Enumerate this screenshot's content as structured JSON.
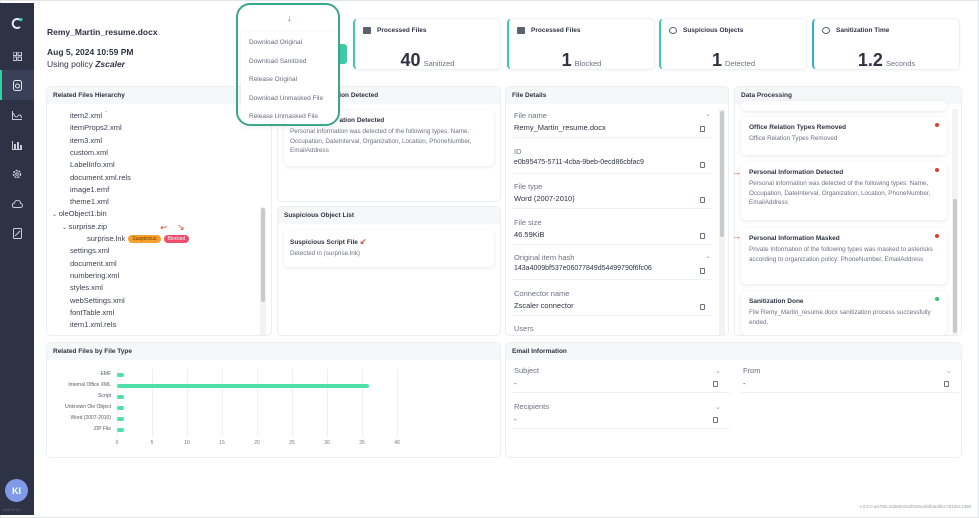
{
  "sidebar": {
    "items": [
      {
        "icon": "logo-icon"
      },
      {
        "icon": "dashboard-icon"
      },
      {
        "icon": "file-scan-icon",
        "active": true
      },
      {
        "icon": "analytics-icon"
      },
      {
        "icon": "reports-icon"
      },
      {
        "icon": "settings-icon"
      },
      {
        "icon": "cloud-icon"
      },
      {
        "icon": "document-icon"
      }
    ],
    "avatar": "KI",
    "version": "v24.07.21"
  },
  "header": {
    "file_name": "Remy_Martin_resume.docx",
    "date": "Aug 5, 2024 10:59 PM",
    "policy_prefix": "Using policy",
    "policy_name": "Zscaler"
  },
  "actions_menu": {
    "items": [
      "Download Original",
      "Download Sanitized",
      "Release Original",
      "Download Unmasked File",
      "Release Unmasked File"
    ]
  },
  "stats": [
    {
      "title": "Processed Files",
      "value": "40",
      "unit": "Sanitized"
    },
    {
      "title": "Processed Files",
      "value": "1",
      "unit": "Blocked"
    },
    {
      "title": "Suspicious Objects",
      "value": "1",
      "unit": "Detected"
    },
    {
      "title": "Sanitization Time",
      "value": "1.2",
      "unit": "Seconds"
    }
  ],
  "hierarchy": {
    "title": "Related Files Hierarchy",
    "items": [
      {
        "name": "item2.xml",
        "level": 1
      },
      {
        "name": "itemProps2.xml",
        "level": 1
      },
      {
        "name": "item3.xml",
        "level": 1
      },
      {
        "name": "custom.xml",
        "level": 1
      },
      {
        "name": "LabelInfo.xml",
        "level": 1
      },
      {
        "name": "document.xml.rels",
        "level": 1
      },
      {
        "name": "image1.emf",
        "level": 1
      },
      {
        "name": "theme1.xml",
        "level": 1
      },
      {
        "name": "oleObject1.bin",
        "level": 0,
        "expanded": true
      },
      {
        "name": "surprise.zip",
        "level": 1,
        "expanded": true
      },
      {
        "name": "surprise.lnk",
        "level": 2,
        "badges": [
          "Suspicious",
          "Blocked"
        ]
      },
      {
        "name": "settings.xml",
        "level": 1
      },
      {
        "name": "document.xml",
        "level": 1
      },
      {
        "name": "numbering.xml",
        "level": 1
      },
      {
        "name": "styles.xml",
        "level": 1
      },
      {
        "name": "webSettings.xml",
        "level": 1
      },
      {
        "name": "fontTable.xml",
        "level": 1
      },
      {
        "name": "item1.xml.rels",
        "level": 1
      }
    ]
  },
  "pii": {
    "title": "Personal Information Detected",
    "card_title": "Personal Information Detected",
    "card_desc": "Personal information was detected of the following types: Name, Occupation, DateInterval, Organization, Location, PhoneNumber, EmailAddress"
  },
  "suspicious": {
    "title": "Suspicious Object List",
    "card_title": "Suspicious Script File",
    "card_desc": "Detected in (surprise.lnk)"
  },
  "file_details": {
    "title": "File Details",
    "fields": [
      {
        "label": "File name",
        "value": "Remy_Martin_resume.docx"
      },
      {
        "label": "ID",
        "value": "e0b95475-5711-4cba-9beb-0ecd86cbfac9"
      },
      {
        "label": "File type",
        "value": "Word (2007-2010)"
      },
      {
        "label": "File size",
        "value": "46.59KiB"
      },
      {
        "label": "Original item hash",
        "value": "143a4009bf537e06077849d54499790f6fc06"
      },
      {
        "label": "Connector name",
        "value": "Zscaler connector"
      },
      {
        "label": "Users",
        "value": ""
      }
    ]
  },
  "data_processing": {
    "title": "Data Processing",
    "items": [
      {
        "title": "Office Relation Types Removed",
        "desc": "Office Relation Types Removed",
        "status": "red"
      },
      {
        "title": "Personal Information Detected",
        "desc": "Personal information was detected of the following types: Name, Occupation, DateInterval, Organization, Location, PhoneNumber, EmailAddress",
        "status": "red"
      },
      {
        "title": "Personal Information Masked",
        "desc": "Private Information of the following types was masked to asterisks according to organization policy: PhoneNumber, EmailAddress",
        "status": "red"
      },
      {
        "title": "Sanitization Done",
        "desc": "File Remy_Martin_resume.docx sanitization process successfully ended.",
        "status": "green"
      }
    ]
  },
  "chart_data": {
    "type": "bar",
    "orientation": "horizontal",
    "title": "Related Files by File Type",
    "categories": [
      "EMF",
      "Internal Office XML",
      "Script",
      "Unknown Ole Object",
      "Word (2007-2010)",
      "ZIP File"
    ],
    "values": [
      1,
      36,
      1,
      1,
      1,
      1
    ],
    "xlim": [
      0,
      40
    ],
    "xticks": [
      0,
      5,
      10,
      15,
      20,
      25,
      30,
      35,
      40
    ],
    "grid": true,
    "color": "#4ee0a8"
  },
  "email": {
    "title": "Email Information",
    "fields": [
      {
        "label": "Subject",
        "value": "-"
      },
      {
        "label": "From",
        "value": "-"
      },
      {
        "label": "Recipients",
        "value": "-"
      }
    ]
  },
  "footer": {
    "version": "v.3.0.0.a6755c2d36503a3f628a46dfa6d8b179155c1499"
  }
}
